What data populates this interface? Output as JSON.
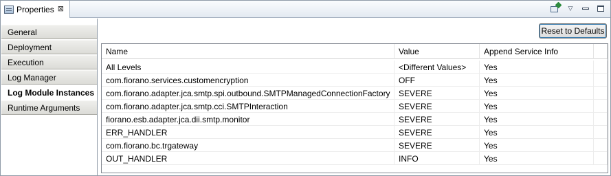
{
  "view_tab": {
    "title": "Properties",
    "close_glyph": "⊠",
    "icon": "properties-view-icon"
  },
  "toolbar": {
    "pin_icon": "pin-to-view-icon",
    "menu_icon": "view-menu-icon",
    "minimize_icon": "minimize-icon",
    "maximize_icon": "maximize-icon"
  },
  "sidebar": {
    "items": [
      {
        "label": "General",
        "selected": false
      },
      {
        "label": "Deployment",
        "selected": false
      },
      {
        "label": "Execution",
        "selected": false
      },
      {
        "label": "Log Manager",
        "selected": false
      },
      {
        "label": "Log Module Instances",
        "selected": true
      },
      {
        "label": "Runtime Arguments",
        "selected": false
      }
    ]
  },
  "main": {
    "reset_button": "Reset to Defaults",
    "table": {
      "columns": [
        "Name",
        "Value",
        "Append Service Info"
      ],
      "rows": [
        {
          "name": "All Levels",
          "value": "<Different Values>",
          "append": "Yes"
        },
        {
          "name": "com.fiorano.services.customencryption",
          "value": "OFF",
          "append": "Yes"
        },
        {
          "name": "com.fiorano.adapter.jca.smtp.spi.outbound.SMTPManagedConnectionFactory",
          "value": "SEVERE",
          "append": "Yes"
        },
        {
          "name": "com.fiorano.adapter.jca.smtp.cci.SMTPInteraction",
          "value": "SEVERE",
          "append": "Yes"
        },
        {
          "name": "fiorano.esb.adapter.jca.dii.smtp.monitor",
          "value": "SEVERE",
          "append": "Yes"
        },
        {
          "name": "ERR_HANDLER",
          "value": "SEVERE",
          "append": "Yes"
        },
        {
          "name": "com.fiorano.bc.trgateway",
          "value": "SEVERE",
          "append": "Yes"
        },
        {
          "name": "OUT_HANDLER",
          "value": "INFO",
          "append": "Yes"
        }
      ]
    }
  }
}
